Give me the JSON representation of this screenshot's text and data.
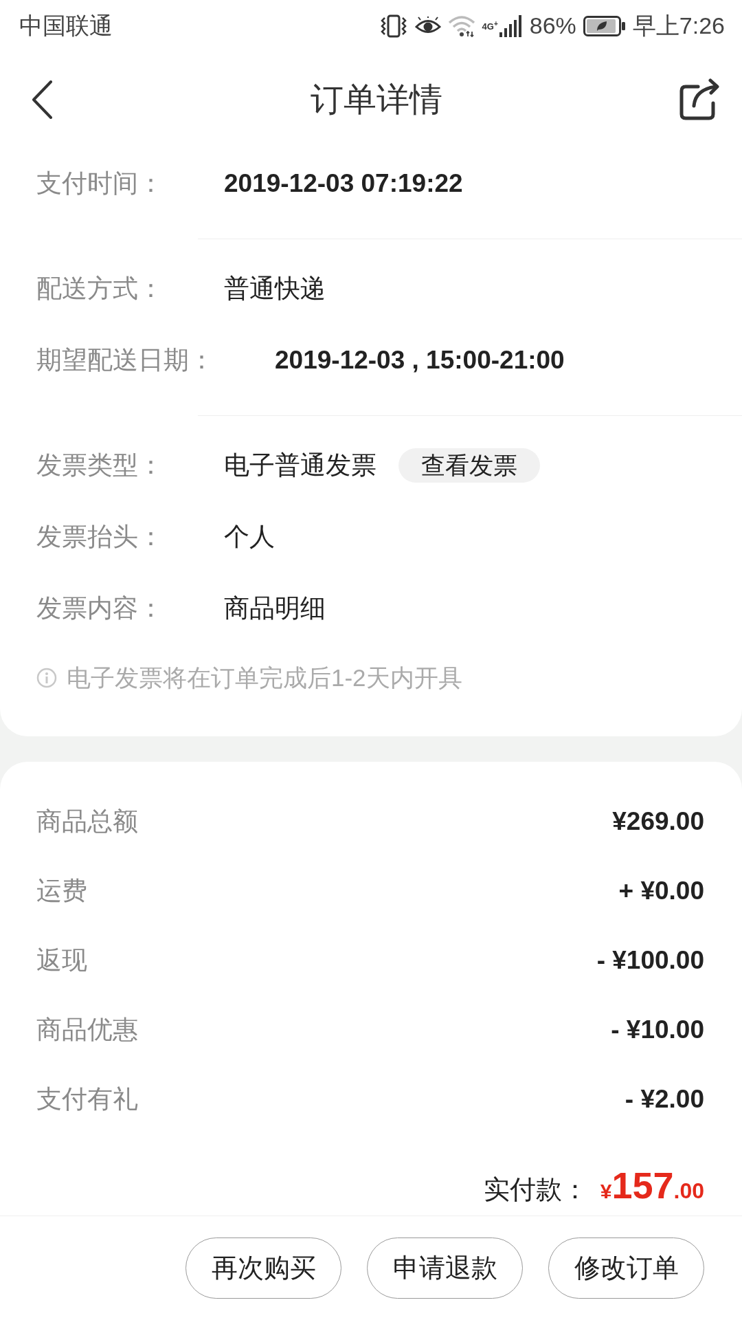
{
  "status_bar": {
    "carrier": "中国联通",
    "network": "4G$^{+}$",
    "battery": "86%",
    "time": "早上7:26"
  },
  "header": {
    "title": "订单详情"
  },
  "order_info": {
    "sections": [
      {
        "rows": [
          {
            "label": "支付时间：",
            "value": "2019-12-03 07:19:22",
            "kind": "emphasis"
          }
        ]
      },
      {
        "rows": [
          {
            "label": "配送方式：",
            "value": "普通快递",
            "kind": "plain"
          },
          {
            "label": "期望配送日期：",
            "value": "2019-12-03 , 15:00-21:00",
            "kind": "emphasis"
          }
        ]
      },
      {
        "rows": [
          {
            "label": "发票类型：",
            "value": "电子普通发票",
            "kind": "plain",
            "action": "查看发票"
          },
          {
            "label": "发票抬头：",
            "value": "个人",
            "kind": "plain"
          },
          {
            "label": "发票内容：",
            "value": "商品明细",
            "kind": "plain"
          }
        ]
      }
    ],
    "note": "电子发票将在订单完成后1-2天内开具"
  },
  "charges": {
    "rows": [
      {
        "label": "商品总额",
        "amount": "¥269.00"
      },
      {
        "label": "运费",
        "amount": "+ ¥0.00"
      },
      {
        "label": "返现",
        "amount": "- ¥100.00"
      },
      {
        "label": "商品优惠",
        "amount": "- ¥10.00"
      },
      {
        "label": "支付有礼",
        "amount": "- ¥2.00"
      }
    ],
    "total": {
      "label": "实付款：",
      "currency": "¥",
      "integer": "157",
      "decimal": ".00"
    }
  },
  "actions": [
    "再次购买",
    "申请退款",
    "修改订单"
  ]
}
